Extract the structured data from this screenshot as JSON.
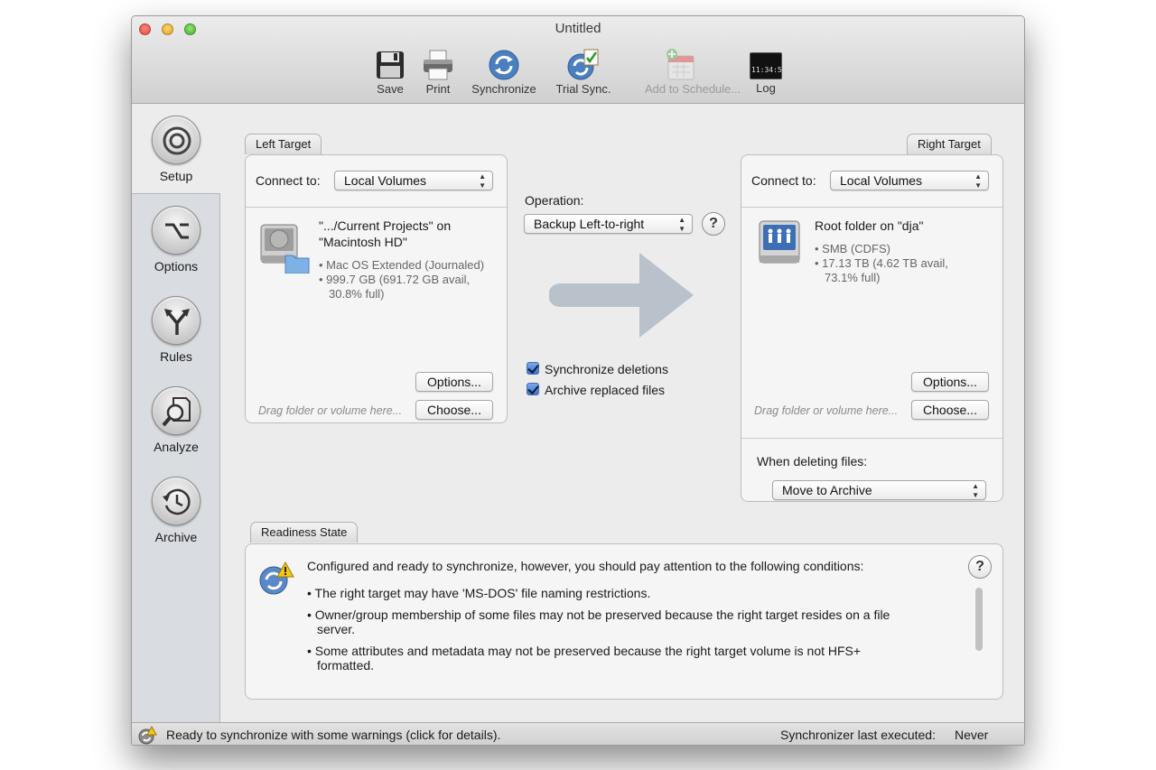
{
  "window": {
    "title": "Untitled"
  },
  "toolbar": {
    "items": [
      {
        "label": "Save",
        "icon": "floppy-disk-icon",
        "enabled": true
      },
      {
        "label": "Print",
        "icon": "printer-icon",
        "enabled": true
      },
      {
        "label": "Synchronize",
        "icon": "sync-icon",
        "enabled": true
      },
      {
        "label": "Trial Sync.",
        "icon": "trial-sync-icon",
        "enabled": true
      },
      {
        "label": "Add to Schedule...",
        "icon": "calendar-add-icon",
        "enabled": false
      },
      {
        "label": "Log",
        "icon": "terminal-log-icon",
        "enabled": true
      }
    ],
    "log_icon_text": "11:34:5"
  },
  "sidebar": {
    "selected": "Setup",
    "items": [
      {
        "label": "Setup",
        "icon": "target-icon"
      },
      {
        "label": "Options",
        "icon": "option-key-icon"
      },
      {
        "label": "Rules",
        "icon": "branch-arrows-icon"
      },
      {
        "label": "Analyze",
        "icon": "magnifier-document-icon"
      },
      {
        "label": "Archive",
        "icon": "clock-history-icon"
      }
    ]
  },
  "left_target": {
    "tab": "Left Target",
    "connect_label": "Connect to:",
    "connect_value": "Local Volumes",
    "folder_name_line1": "\".../Current Projects\" on",
    "folder_name_line2": "\"Macintosh HD\"",
    "format": "Mac OS Extended (Journaled)",
    "capacity_line1": "999.7 GB (691.72 GB avail,",
    "capacity_line2": "30.8% full)",
    "options_button": "Options...",
    "choose_button": "Choose...",
    "drag_hint": "Drag folder or volume here..."
  },
  "operation": {
    "label": "Operation:",
    "value": "Backup Left-to-right",
    "help": "?",
    "arrow_color": "#b9c2cb",
    "sync_deletions_label": "Synchronize deletions",
    "sync_deletions_checked": true,
    "archive_replaced_label": "Archive replaced files",
    "archive_replaced_checked": true
  },
  "right_target": {
    "tab": "Right Target",
    "connect_label": "Connect to:",
    "connect_value": "Local Volumes",
    "folder_name": "Root folder on \"dja\"",
    "format": "SMB (CDFS)",
    "capacity_line1": "17.13 TB (4.62 TB avail,",
    "capacity_line2": "73.1% full)",
    "options_button": "Options...",
    "choose_button": "Choose...",
    "drag_hint": "Drag folder or volume here...",
    "deleting_label": "When deleting files:",
    "deleting_value": "Move to Archive"
  },
  "readiness": {
    "tab": "Readiness State",
    "headline": "Configured and ready to synchronize, however, you should pay attention to the following conditions:",
    "help": "?",
    "bullets": [
      {
        "line1": "• The right target may have 'MS-DOS' file naming restrictions.",
        "line2": ""
      },
      {
        "line1": "• Owner/group membership of some files may not be preserved because the right target resides on a file",
        "line2": "server."
      },
      {
        "line1": "• Some attributes and metadata may not be preserved because the right target volume is not HFS+",
        "line2": "formatted."
      }
    ]
  },
  "status": {
    "message": "Ready to synchronize with some warnings (click for details).",
    "last_executed_label": "Synchronizer last executed:",
    "last_executed_value": "Never"
  }
}
